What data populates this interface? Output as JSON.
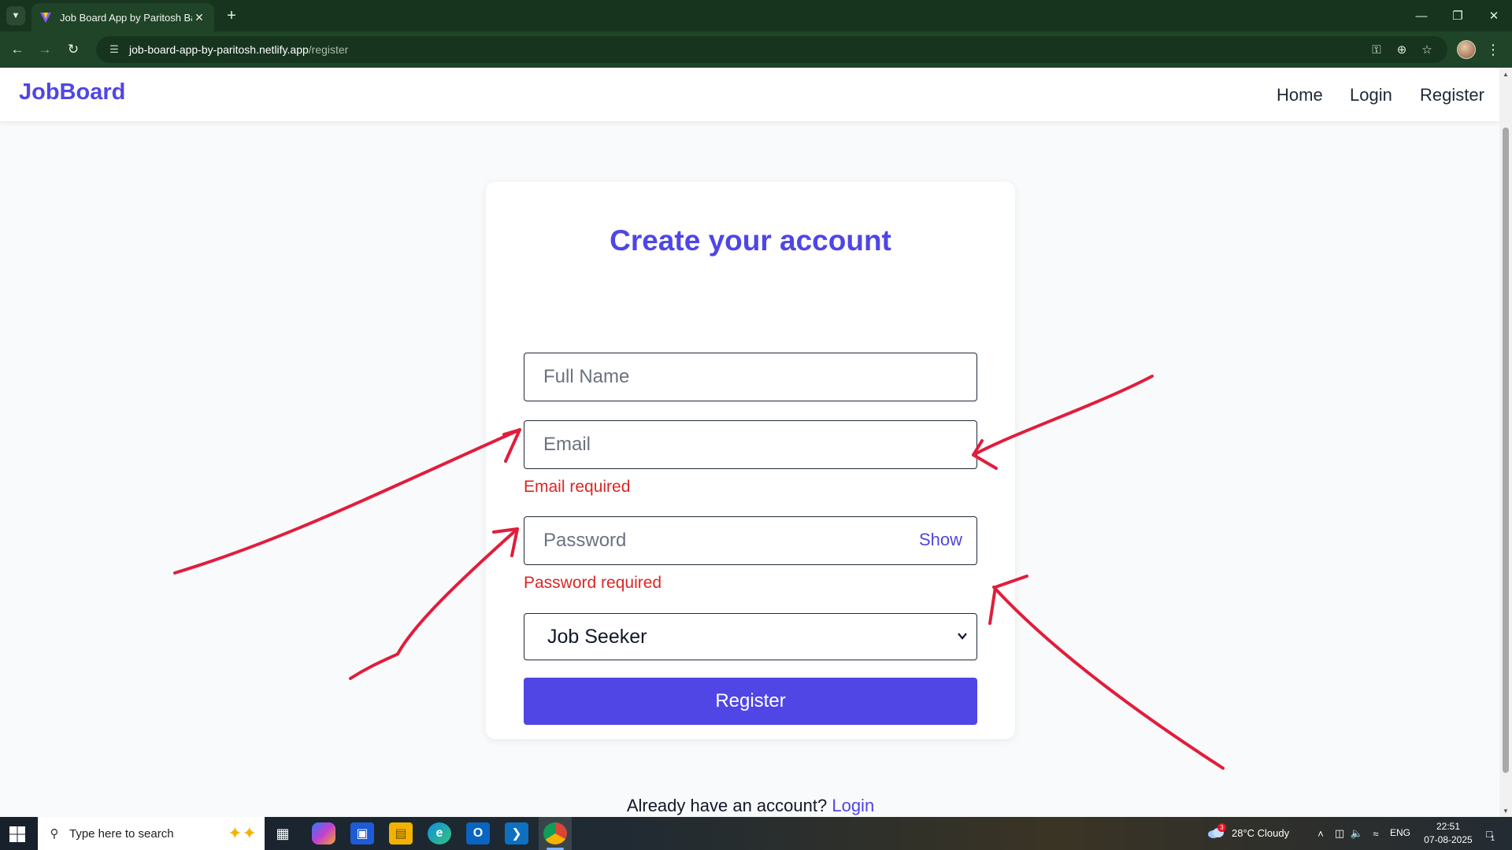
{
  "browser": {
    "tab_title": "Job Board App by Paritosh Barman",
    "new_tab_symbol": "+",
    "url_host": "job-board-app-by-paritosh.netlify.app",
    "url_path": "/register"
  },
  "site": {
    "brand": "JobBoard",
    "nav": {
      "home": "Home",
      "login": "Login",
      "register": "Register"
    }
  },
  "form": {
    "title": "Create your account",
    "full_name_placeholder": "Full Name",
    "email_placeholder": "Email",
    "email_error": "Email required",
    "password_placeholder": "Password",
    "show_label": "Show",
    "password_error": "Password required",
    "role_selected": "Job Seeker",
    "submit_label": "Register",
    "footer_text": "Already have an account?",
    "footer_link": "Login"
  },
  "taskbar": {
    "search_placeholder": "Type here to search",
    "weather_badge": "3",
    "weather": "28°C  Cloudy",
    "language": "ENG",
    "time": "22:51",
    "date": "07-08-2025",
    "notification_count": "1"
  },
  "colors": {
    "accent": "#4f46e5",
    "error": "#dc2626",
    "annotation": "#e11d3c",
    "browser_frame": "#1f4427"
  }
}
